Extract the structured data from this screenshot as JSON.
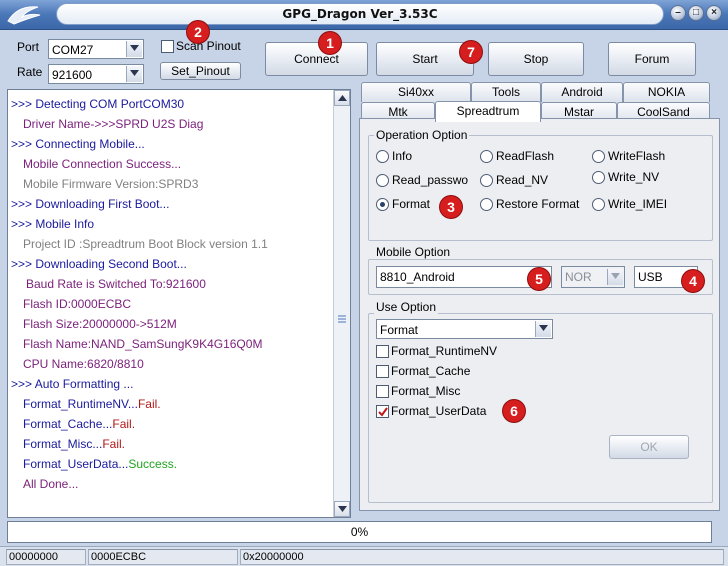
{
  "window": {
    "title": "GPG_Dragon  Ver_3.53C",
    "minimize_label": "–",
    "maximize_label": "□",
    "close_label": "×"
  },
  "connection": {
    "port_label": "Port",
    "port_value": "COM27",
    "rate_label": "Rate",
    "rate_value": "921600",
    "scan_pinout_label": "Scan Pinout",
    "scan_pinout_checked": false,
    "set_pinout_label": "Set_Pinout"
  },
  "toolbar": {
    "connect_label": "Connect",
    "start_label": "Start",
    "stop_label": "Stop",
    "forum_label": "Forum"
  },
  "badges": [
    "1",
    "2",
    "3",
    "4",
    "5",
    "6",
    "7"
  ],
  "log": [
    {
      "text": ">>> Detecting COM PortCOM30",
      "color": "#1a1a9c"
    },
    {
      "text": "Driver Name->>>SPRD U2S Diag",
      "color": "#7a1f7a"
    },
    {
      "text": ">>> Connecting Mobile...",
      "color": "#1a1a9c"
    },
    {
      "text": "Mobile Connection Success...",
      "color": "#7a1f7a"
    },
    {
      "text": "Mobile Firmware Version:SPRD3",
      "color": "#808080"
    },
    {
      "text": ">>> Downloading First Boot...",
      "color": "#1a1a9c"
    },
    {
      "text": ">>> Mobile Info",
      "color": "#1a1a9c"
    },
    {
      "text": "Project ID :Spreadtrum Boot Block version 1.1",
      "color": "#808080"
    },
    {
      "text": ">>> Downloading Second Boot...",
      "color": "#1a1a9c"
    },
    {
      "text": "Baud Rate is Switched To:921600",
      "color": "#7a1f7a"
    },
    {
      "text": "Flash ID:0000ECBC",
      "color": "#7a1f7a"
    },
    {
      "text": "Flash Size:20000000->512M",
      "color": "#7a1f7a"
    },
    {
      "text": "Flash Name:NAND_SamSungK9K4G16Q0M",
      "color": "#7a1f7a"
    },
    {
      "text": "CPU Name:6820/8810",
      "color": "#7a1f7a"
    },
    {
      "text": ">>> Auto Formatting ...",
      "color": "#1a1a9c"
    }
  ],
  "log_results": [
    {
      "prefix": "Format_RuntimeNV...",
      "result": "Fail.",
      "result_color": "#b01818"
    },
    {
      "prefix": "Format_Cache...",
      "result": "Fail.",
      "result_color": "#b01818"
    },
    {
      "prefix": "Format_Misc...",
      "result": "Fail.",
      "result_color": "#b01818"
    },
    {
      "prefix": "Format_UserData...",
      "result": "Success.",
      "result_color": "#1fa51f"
    }
  ],
  "log_done": "All Done...",
  "tabs_row1": [
    "Si40xx",
    "Tools",
    "Android",
    "NOKIA"
  ],
  "tabs_row2": [
    "Mtk",
    "Spreadtrum",
    "Mstar",
    "CoolSand"
  ],
  "active_tab": "Spreadtrum",
  "operation": {
    "title": "Operation Option",
    "options": [
      "Info",
      "ReadFlash",
      "WriteFlash",
      "Read_passwo",
      "Read_NV",
      "Write_NV",
      "Format",
      "Restore Format",
      "Write_IMEI"
    ],
    "selected": "Format"
  },
  "mobile": {
    "title": "Mobile Option",
    "model_value": "8810_Android",
    "flash_type": "NOR",
    "interface": "USB"
  },
  "use": {
    "title": "Use Option",
    "mode_value": "Format",
    "checks": [
      {
        "label": "Format_RuntimeNV",
        "checked": false
      },
      {
        "label": "Format_Cache",
        "checked": false
      },
      {
        "label": "Format_Misc",
        "checked": false
      },
      {
        "label": "Format_UserData",
        "checked": true
      }
    ],
    "ok_label": "OK"
  },
  "progress": {
    "percent": 0,
    "label": "0%"
  },
  "status": [
    "00000000",
    "0000ECBC",
    "0x20000000"
  ],
  "colors": {
    "badge": "#d61e1e",
    "accent": "#4a77b8"
  }
}
